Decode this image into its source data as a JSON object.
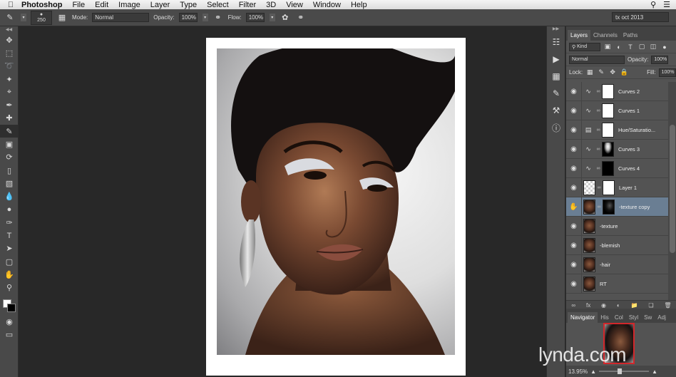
{
  "menubar": {
    "app": "Photoshop",
    "items": [
      "File",
      "Edit",
      "Image",
      "Layer",
      "Type",
      "Select",
      "Filter",
      "3D",
      "View",
      "Window",
      "Help"
    ]
  },
  "options": {
    "brush_size": "250",
    "mode_label": "Mode:",
    "mode_value": "Normal",
    "opacity_label": "Opacity:",
    "opacity_value": "100%",
    "flow_label": "Flow:",
    "flow_value": "100%",
    "workspace": "tx oct 2013"
  },
  "panels": {
    "tabs": [
      "Layers",
      "Channels",
      "Paths"
    ],
    "kind_filter": "Kind",
    "blend_mode": "Normal",
    "opacity_label": "Opacity:",
    "opacity_value": "100%",
    "lock_label": "Lock:",
    "fill_label": "Fill:",
    "fill_value": "100%"
  },
  "layers": [
    {
      "name": "Curves 2",
      "type": "adjustment",
      "mask": "white"
    },
    {
      "name": "Curves 1",
      "type": "adjustment",
      "mask": "white"
    },
    {
      "name": "Hue/Saturatio...",
      "type": "adjustment",
      "mask": "white"
    },
    {
      "name": "Curves 3",
      "type": "adjustment",
      "mask": "curvemask"
    },
    {
      "name": "Curves 4",
      "type": "adjustment",
      "mask": "black"
    },
    {
      "name": "Layer 1",
      "type": "transparent",
      "mask": "white"
    },
    {
      "name": "-texture copy",
      "type": "image",
      "mask": "blackmask",
      "selected": true
    },
    {
      "name": "-texture",
      "type": "image"
    },
    {
      "name": "-blemish",
      "type": "image"
    },
    {
      "name": "-hair",
      "type": "image"
    },
    {
      "name": "RT",
      "type": "image"
    }
  ],
  "navigator": {
    "tabs": [
      "Navigator",
      "His",
      "Col",
      "Styl",
      "Sw",
      "Adj"
    ],
    "zoom": "13.95%"
  },
  "watermark": {
    "text": "lynda",
    "suffix": ".com"
  }
}
